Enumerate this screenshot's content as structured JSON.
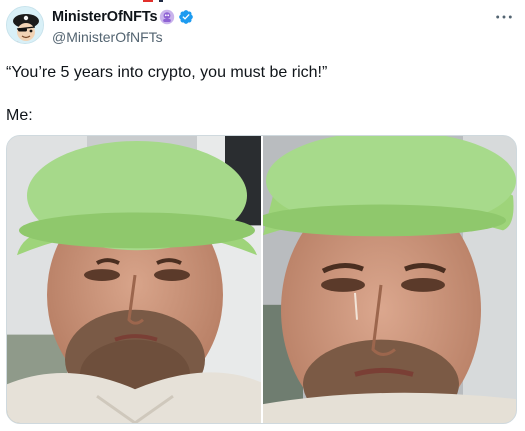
{
  "tweet": {
    "author": {
      "display_name": "MinisterOfNFTs",
      "handle": "@MinisterOfNFTs"
    },
    "icons": {
      "nft_badge": "nft-badge-icon",
      "verified": "verified-badge-icon",
      "more": "more-horizontal-icon"
    },
    "colors": {
      "verified": "#1d9bf0",
      "secondary_text": "#536471",
      "hat_green": "#9ed47a"
    },
    "quote": "“You’re 5 years into crypto, you must be rich!”",
    "reply": "Me:"
  }
}
